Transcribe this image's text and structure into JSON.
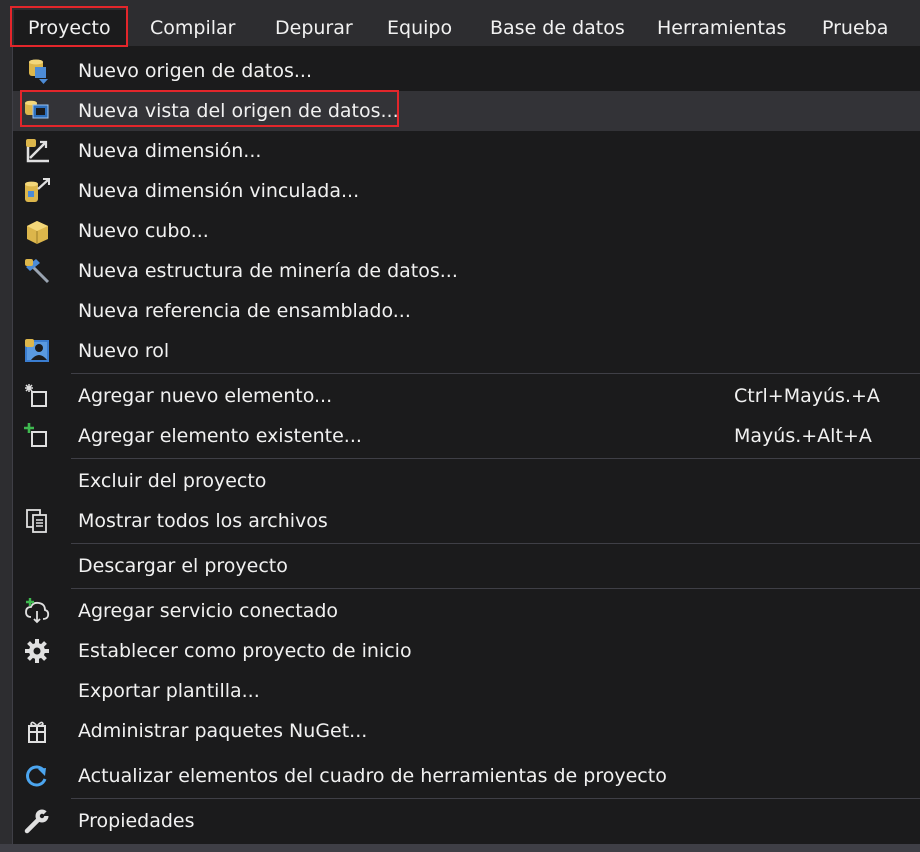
{
  "menubar": {
    "items": [
      "Proyecto",
      "Compilar",
      "Depurar",
      "Equipo",
      "Base de datos",
      "Herramientas",
      "Prueba"
    ]
  },
  "menu": {
    "items": [
      {
        "label": "Nuevo origen de datos...",
        "icon": "data-source-icon"
      },
      {
        "label": "Nueva vista del origen de datos...",
        "icon": "data-source-view-icon"
      },
      {
        "label": "Nueva dimensión...",
        "icon": "dimension-icon"
      },
      {
        "label": "Nueva dimensión vinculada...",
        "icon": "linked-dimension-icon"
      },
      {
        "label": "Nuevo cubo...",
        "icon": "cube-icon"
      },
      {
        "label": "Nueva estructura de minería de datos...",
        "icon": "mining-structure-icon"
      },
      {
        "label": "Nueva referencia de ensamblado...",
        "icon": ""
      },
      {
        "label": "Nuevo rol",
        "icon": "role-icon"
      },
      {
        "label": "Agregar nuevo elemento...",
        "icon": "add-new-item-icon",
        "shortcut": "Ctrl+Mayús.+A"
      },
      {
        "label": "Agregar elemento existente...",
        "icon": "add-existing-item-icon",
        "shortcut": "Mayús.+Alt+A"
      },
      {
        "label": "Excluir del proyecto",
        "icon": ""
      },
      {
        "label": "Mostrar todos los archivos",
        "icon": "show-all-files-icon"
      },
      {
        "label": "Descargar el proyecto",
        "icon": ""
      },
      {
        "label": "Agregar servicio conectado",
        "icon": "connected-service-icon"
      },
      {
        "label": "Establecer como proyecto de inicio",
        "icon": "gear-icon"
      },
      {
        "label": "Exportar plantilla...",
        "icon": ""
      },
      {
        "label": "Administrar paquetes NuGet...",
        "icon": "nuget-package-icon"
      },
      {
        "label": "Actualizar elementos del cuadro de herramientas de proyecto",
        "icon": "refresh-icon"
      },
      {
        "label": "Propiedades",
        "icon": "wrench-icon"
      }
    ]
  },
  "colors": {
    "menu_bg": "#1b1b1c",
    "bar_bg": "#2d2d30",
    "text": "#f1f1f1",
    "highlight_border": "#e3262b",
    "hover_bg": "#333337"
  }
}
